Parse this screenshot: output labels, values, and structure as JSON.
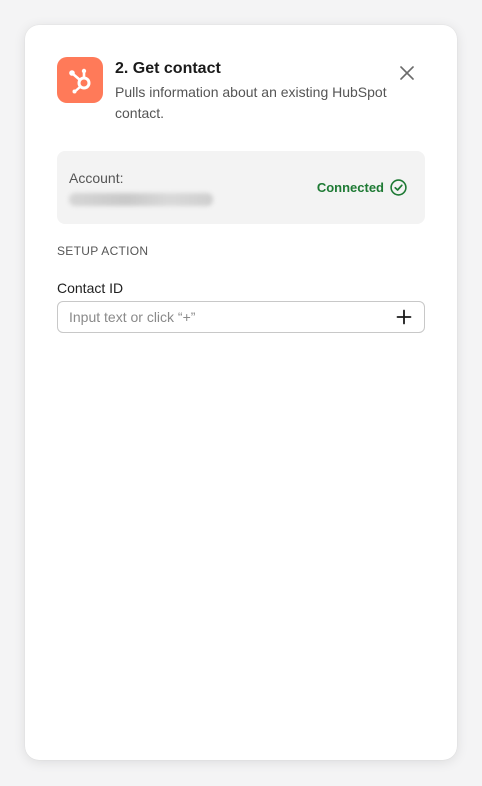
{
  "step": {
    "title": "2. Get contact",
    "description": "Pulls information about an existing HubSpot contact.",
    "app_icon": "hubspot-sprocket-icon",
    "app_color": "#ff7a59"
  },
  "close_icon": "close-icon",
  "account": {
    "label": "Account:",
    "status": "Connected",
    "status_color": "#1e7a34",
    "status_icon": "check-circle-icon"
  },
  "section": {
    "label": "SETUP ACTION"
  },
  "fields": {
    "contact_id": {
      "label": "Contact ID",
      "placeholder": "Input text or click “+”",
      "value": "",
      "add_icon": "plus-icon"
    }
  }
}
